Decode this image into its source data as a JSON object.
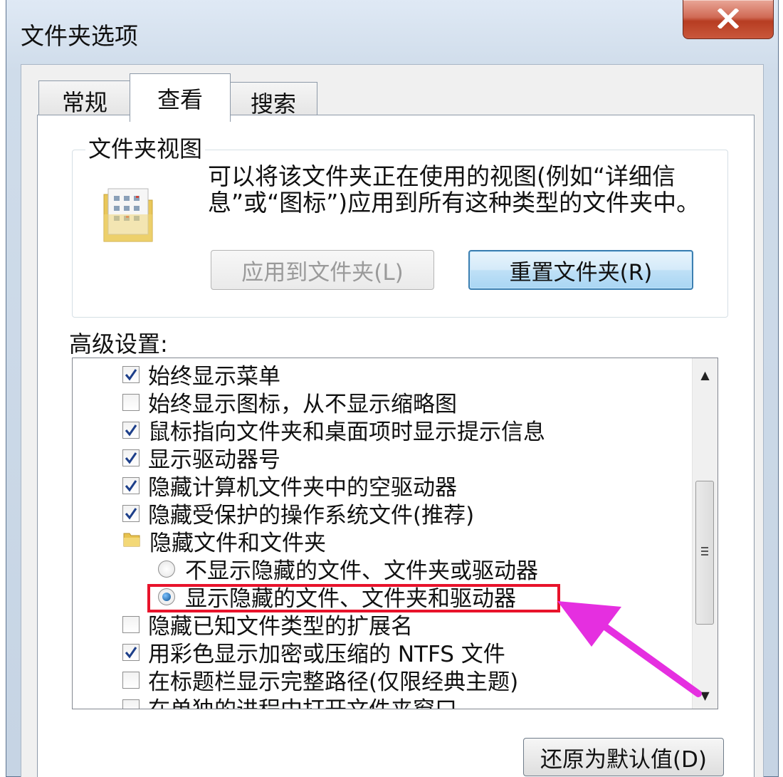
{
  "window": {
    "title": "文件夹选项"
  },
  "tabs": [
    {
      "label": "常规",
      "active": false
    },
    {
      "label": "查看",
      "active": true
    },
    {
      "label": "搜索",
      "active": false
    }
  ],
  "folder_views": {
    "title": "文件夹视图",
    "description": "可以将该文件夹正在使用的视图(例如“详细信息”或“图标”)应用到所有这种类型的文件夹中。",
    "apply_button": "应用到文件夹(L)",
    "reset_button": "重置文件夹(R)"
  },
  "advanced": {
    "label": "高级设置:",
    "items": [
      {
        "type": "checkbox",
        "checked": true,
        "label": "始终显示菜单"
      },
      {
        "type": "checkbox",
        "checked": false,
        "label": "始终显示图标，从不显示缩略图"
      },
      {
        "type": "checkbox",
        "checked": true,
        "label": "鼠标指向文件夹和桌面项时显示提示信息"
      },
      {
        "type": "checkbox",
        "checked": true,
        "label": "显示驱动器号"
      },
      {
        "type": "checkbox",
        "checked": true,
        "label": "隐藏计算机文件夹中的空驱动器"
      },
      {
        "type": "checkbox",
        "checked": true,
        "label": "隐藏受保护的操作系统文件(推荐)"
      },
      {
        "type": "folder",
        "label": "隐藏文件和文件夹"
      },
      {
        "type": "radio",
        "checked": false,
        "label": "不显示隐藏的文件、文件夹或驱动器"
      },
      {
        "type": "radio",
        "checked": true,
        "label": "显示隐藏的文件、文件夹和驱动器"
      },
      {
        "type": "checkbox",
        "checked": false,
        "label": "隐藏已知文件类型的扩展名"
      },
      {
        "type": "checkbox",
        "checked": true,
        "label": "用彩色显示加密或压缩的 NTFS 文件"
      },
      {
        "type": "checkbox",
        "checked": false,
        "label": "在标题栏显示完整路径(仅限经典主题)"
      },
      {
        "type": "checkbox",
        "checked": false,
        "label": "在单独的进程中打开文件夹窗口"
      }
    ]
  },
  "restore_button": "还原为默认值(D)",
  "colors": {
    "highlight": "#e8132b",
    "arrow": "#e52fe0"
  }
}
